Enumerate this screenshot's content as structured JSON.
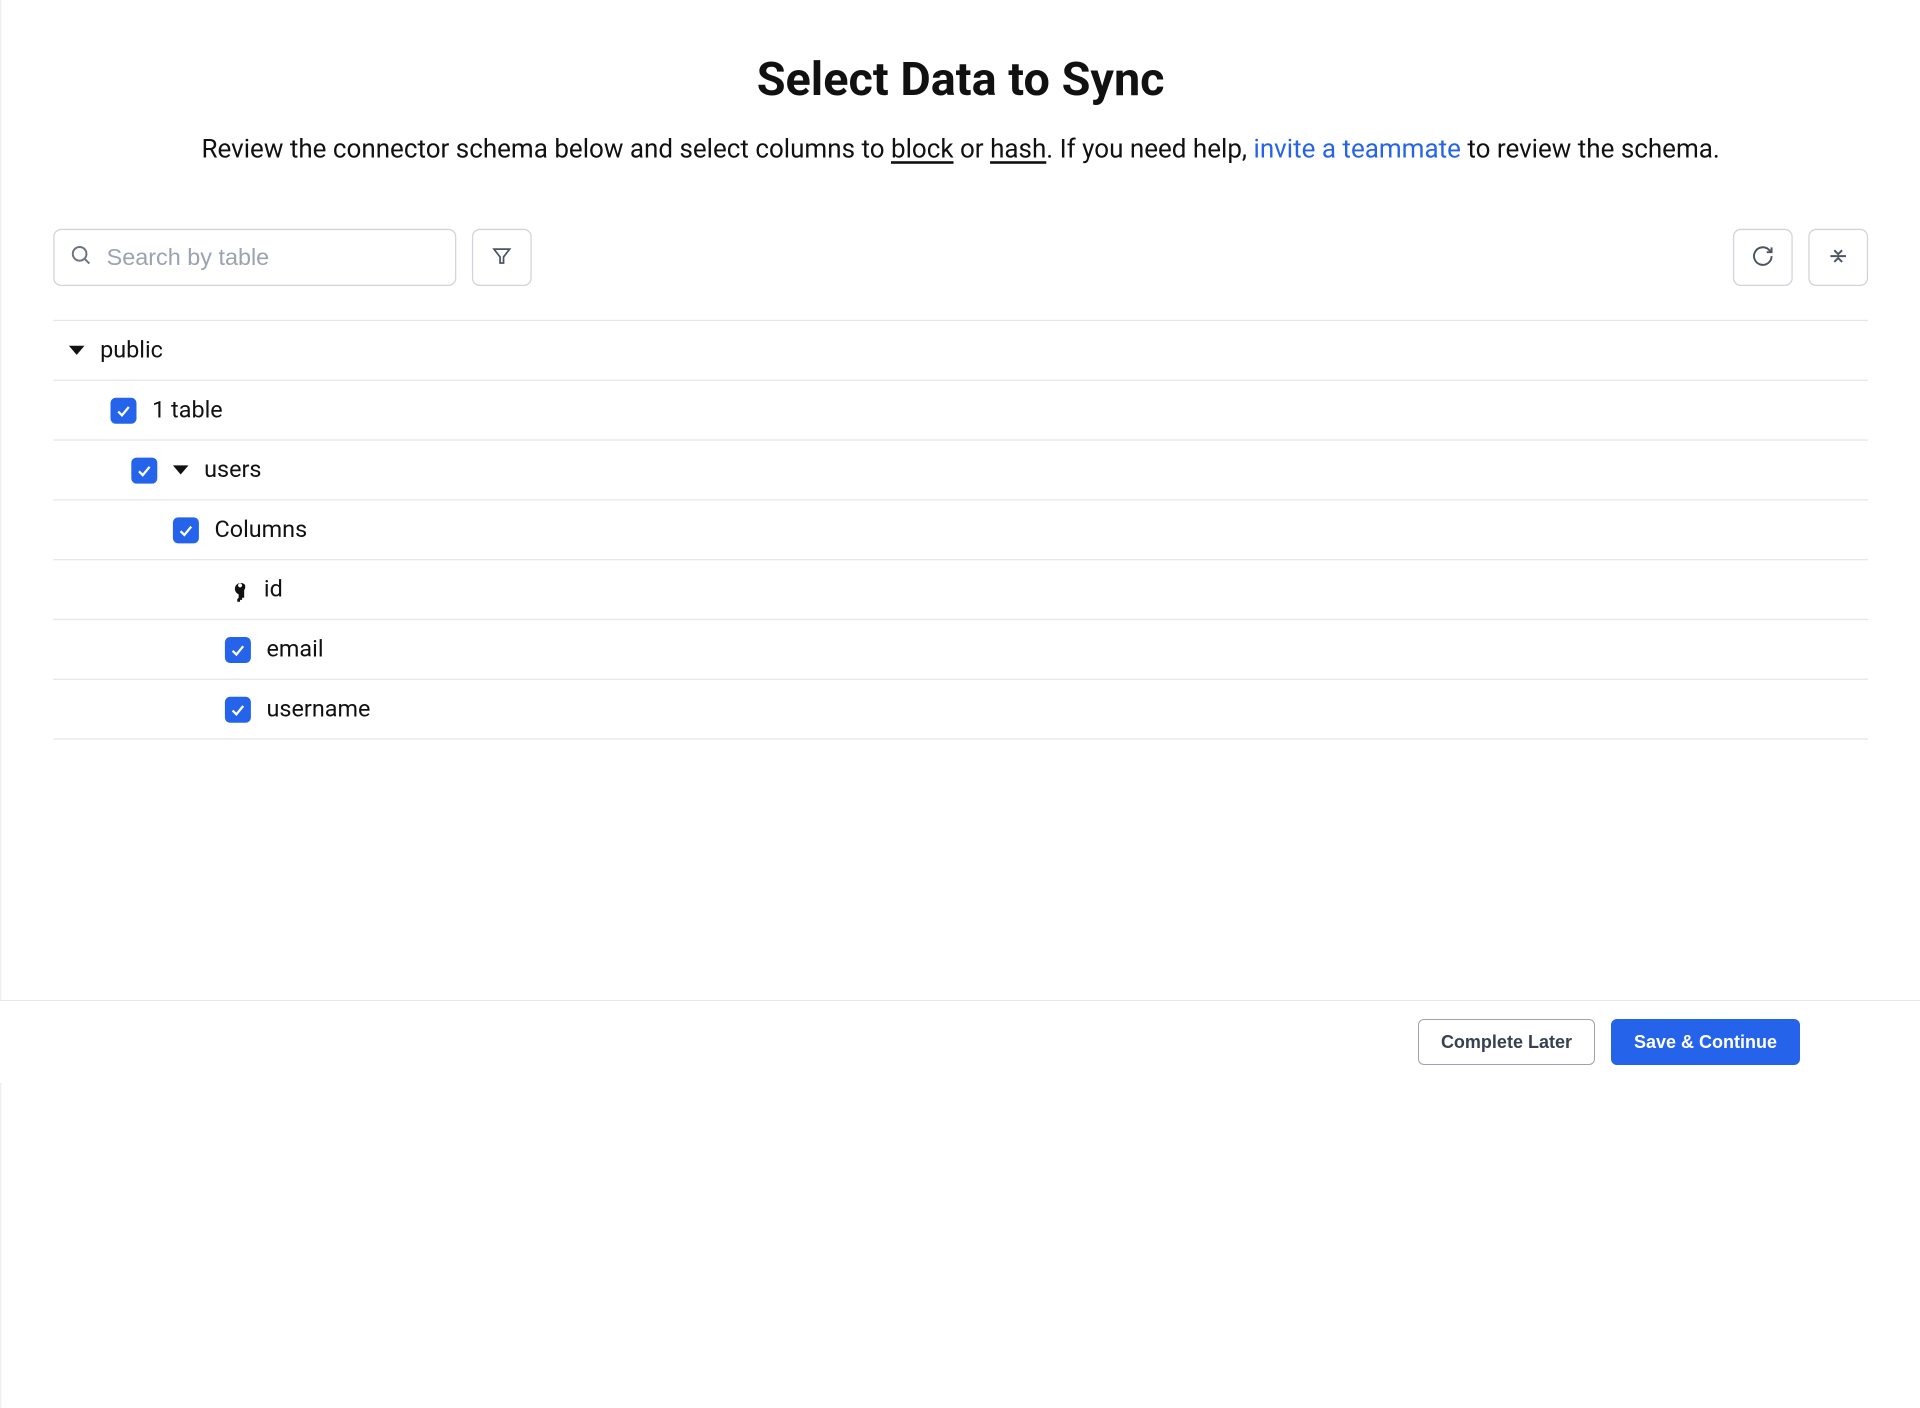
{
  "header": {
    "title": "Select Data to Sync",
    "subtitle_pre": "Review the connector schema below and select columns to ",
    "subtitle_block": "block",
    "subtitle_or": " or ",
    "subtitle_hash": "hash",
    "subtitle_mid": ". If you need help, ",
    "subtitle_link": "invite a teammate",
    "subtitle_post": " to review the schema."
  },
  "toolbar": {
    "search_placeholder": "Search by table"
  },
  "schema": {
    "schema_name": "public",
    "table_count_label": "1 table",
    "table_name": "users",
    "columns_label": "Columns",
    "columns": {
      "id": "id",
      "email": "email",
      "username": "username"
    }
  },
  "footer": {
    "complete_later": "Complete Later",
    "save_continue": "Save & Continue"
  }
}
